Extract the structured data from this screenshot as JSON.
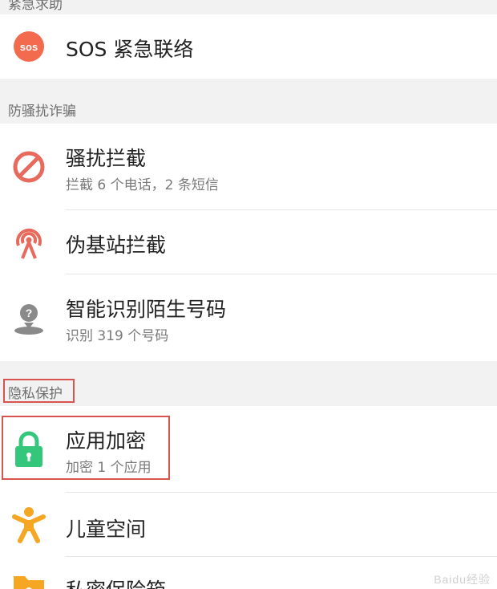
{
  "sections": {
    "emergency": {
      "title": "紧急求助"
    },
    "anti_fraud": {
      "title": "防骚扰诈骗"
    },
    "privacy": {
      "title": "隐私保护"
    }
  },
  "items": {
    "sos": {
      "title": "SOS 紧急联络",
      "icon_text": "sos",
      "icon": "sos-icon",
      "color": "#f26b4f"
    },
    "harass": {
      "title": "骚扰拦截",
      "subtitle": "拦截 6 个电话，2 条短信",
      "icon": "block-icon",
      "color": "#e86a5c"
    },
    "fake_station": {
      "title": "伪基站拦截",
      "icon": "signal-tower-icon",
      "color": "#e86a5c"
    },
    "smart_id": {
      "title": "智能识别陌生号码",
      "subtitle": "识别 319 个号码",
      "icon": "unknown-person-icon",
      "color": "#8a8a8a"
    },
    "app_lock": {
      "title": "应用加密",
      "subtitle": "加密 1 个应用",
      "icon": "lock-icon",
      "color": "#34c77b"
    },
    "kids": {
      "title": "儿童空间",
      "icon": "child-icon",
      "color": "#f5a623"
    },
    "safe_box": {
      "title": "私密保险箱",
      "icon": "folder-icon",
      "color": "#f5a623"
    }
  },
  "highlight_color": "#d9534f",
  "watermark": "Baidu经验"
}
